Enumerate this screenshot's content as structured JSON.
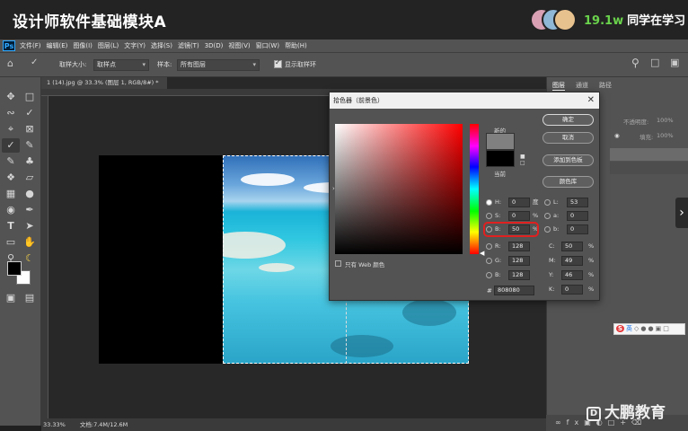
{
  "course": {
    "title": "设计师软件基础模块A",
    "viewer_count": "19.1w",
    "viewer_text": "同学在学习"
  },
  "menubar": {
    "logo": "Ps",
    "items": [
      "文件(F)",
      "编辑(E)",
      "图像(I)",
      "图层(L)",
      "文字(Y)",
      "选择(S)",
      "滤镜(T)",
      "3D(D)",
      "视图(V)",
      "窗口(W)",
      "帮助(H)"
    ]
  },
  "options": {
    "sample_size_label": "取样大小:",
    "sample_size_value": "取样点",
    "sample_label": "样本:",
    "sample_value": "所有图层",
    "show_ring_label": "显示取样环"
  },
  "document": {
    "tab_title": "1 (14).jpg @ 33.3% (图层 1, RGB/8#) *",
    "zoom": "33.33%",
    "doc_info": "文档:7.4M/12.6M"
  },
  "panels": {
    "tabs": [
      "图层",
      "通道",
      "路径"
    ],
    "opacity_label": "不透明度:",
    "opacity_value": "100%",
    "fill_label": "填充:",
    "fill_value": "100%"
  },
  "color_picker": {
    "title": "拾色器（前景色）",
    "new_label": "新的",
    "current_label": "当前",
    "ok_label": "确定",
    "cancel_label": "取消",
    "add_swatch_label": "添加到色板",
    "color_lib_label": "颜色库",
    "web_only_label": "只有 Web 颜色",
    "new_color": "#808080",
    "current_color": "#000000",
    "fields_left": [
      {
        "label": "H:",
        "value": "0",
        "unit": "度",
        "selected": true
      },
      {
        "label": "S:",
        "value": "0",
        "unit": "%",
        "selected": false
      },
      {
        "label": "B:",
        "value": "50",
        "unit": "%",
        "selected": false
      },
      {
        "label": "R:",
        "value": "128",
        "unit": "",
        "selected": false
      },
      {
        "label": "G:",
        "value": "128",
        "unit": "",
        "selected": false
      },
      {
        "label": "B:",
        "value": "128",
        "unit": "",
        "selected": false
      }
    ],
    "fields_right": [
      {
        "label": "L:",
        "value": "53",
        "unit": ""
      },
      {
        "label": "a:",
        "value": "0",
        "unit": ""
      },
      {
        "label": "b:",
        "value": "0",
        "unit": ""
      },
      {
        "label": "C:",
        "value": "50",
        "unit": "%"
      },
      {
        "label": "M:",
        "value": "49",
        "unit": "%"
      },
      {
        "label": "Y:",
        "value": "46",
        "unit": "%"
      },
      {
        "label": "K:",
        "value": "0",
        "unit": "%"
      }
    ],
    "hex_label": "#",
    "hex_value": "808080"
  },
  "ime": {
    "s_logo": "S",
    "lang": "英"
  },
  "watermark": {
    "logo": "D",
    "text": "大鹏教育"
  },
  "colors": {
    "accent_green": "#6ad34c",
    "highlight_red": "#e02020",
    "ps_blue": "#31a8ff"
  }
}
